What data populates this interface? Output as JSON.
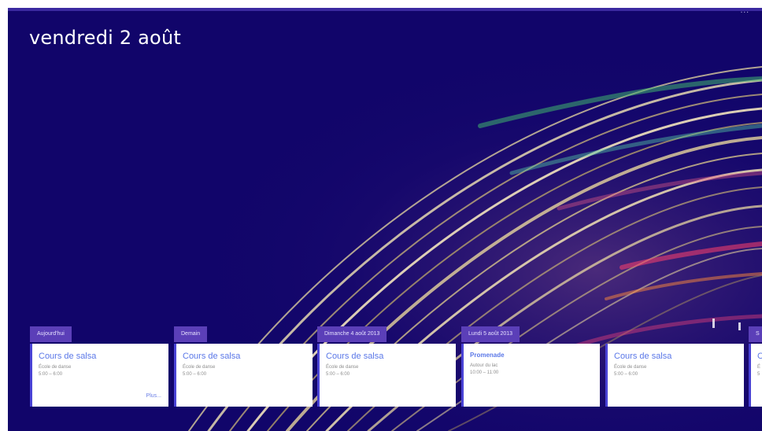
{
  "header": {
    "date_title": "vendredi 2 août",
    "menu_glyph": "..."
  },
  "days": [
    {
      "label": "Aujourd'hui",
      "event": {
        "title": "Cours de salsa",
        "location": "École de danse",
        "time": "5:00 – 6:00"
      },
      "more_label": "Plus..."
    },
    {
      "label": "Demain",
      "event": {
        "title": "Cours de salsa",
        "location": "École de danse",
        "time": "5:00 – 6:00"
      }
    },
    {
      "label": "Dimanche 4 août 2013",
      "event": {
        "title": "Cours de salsa",
        "location": "École de danse",
        "time": "5:00 – 6:00"
      }
    },
    {
      "label": "Lundi 5 août 2013",
      "event": {
        "title": "Promenade",
        "location": "Autour du lac",
        "time": "10:00 – 11:00"
      }
    },
    {
      "label": "",
      "event": {
        "title": "Cours de salsa",
        "location": "École de danse",
        "time": "5:00 – 6:00"
      }
    },
    {
      "label": "S",
      "event": {
        "title": "C",
        "location": "É",
        "time": "5"
      }
    }
  ],
  "colors": {
    "background": "#11056a",
    "day_header": "#5b3fb8",
    "event_title": "#5b78e8",
    "card_accent": "#4a43d6"
  }
}
